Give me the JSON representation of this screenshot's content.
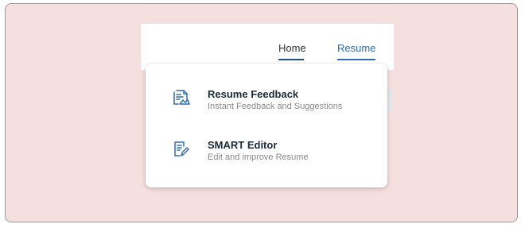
{
  "nav": {
    "home_label": "Home",
    "resume_label": "Resume",
    "active_color": "#2f6fb0"
  },
  "dropdown": {
    "items": [
      {
        "title": "Resume Feedback",
        "subtitle": "Instant Feedback and Suggestions",
        "icon": "resume-feedback-icon"
      },
      {
        "title": "SMART Editor",
        "subtitle": "Edit and improve Resume",
        "icon": "document-edit-icon"
      }
    ]
  },
  "colors": {
    "frame_background": "#f6dfdf",
    "icon_color": "#2f6fb0"
  }
}
